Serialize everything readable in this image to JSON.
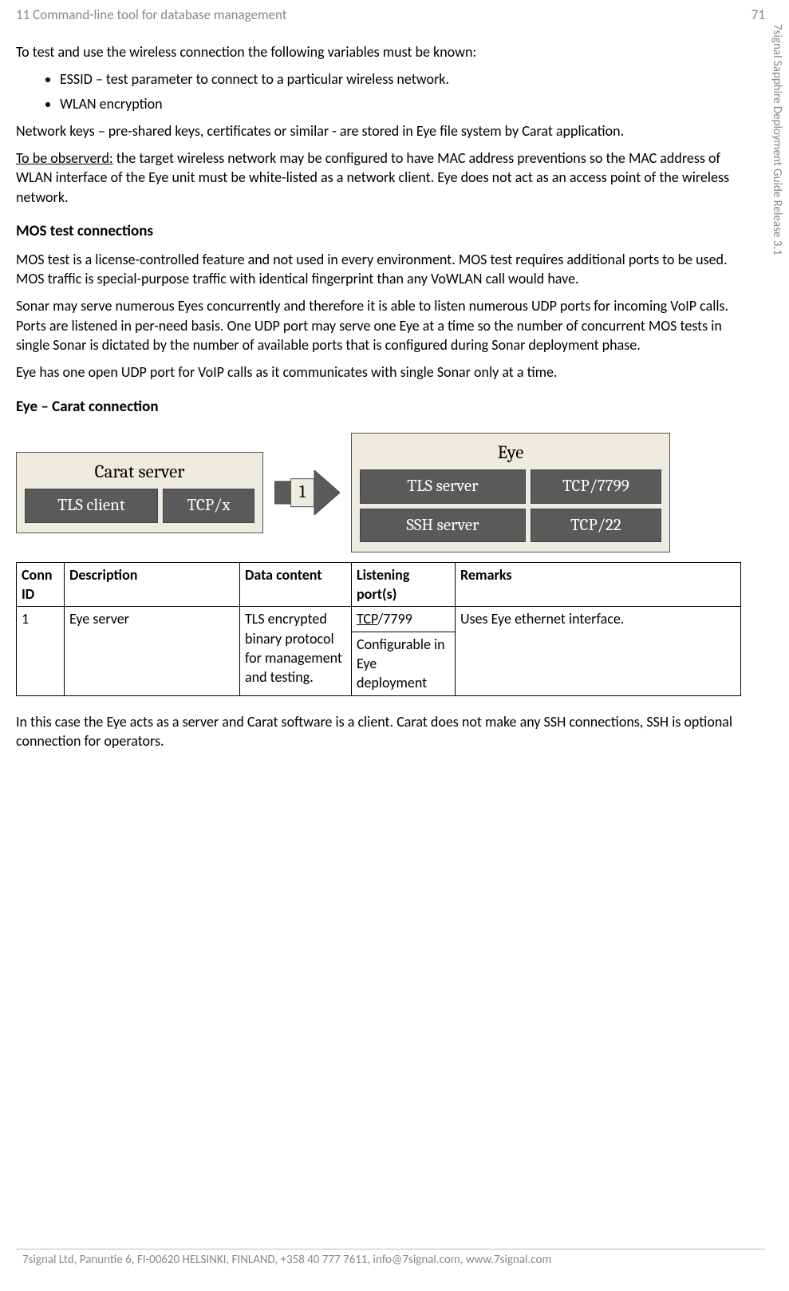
{
  "header": {
    "left": "11 Command-line tool for database management",
    "right": "71"
  },
  "side": "7signal Sapphire Deployment Guide Release 3.1",
  "intro": "To test and use the wireless connection the following variables must be known:",
  "bullets": [
    "ESSID – test parameter to connect to a particular wireless network.",
    "WLAN encryption"
  ],
  "p_netkeys": "Network keys – pre-shared keys, certificates or similar - are stored in Eye file system by Carat application.",
  "obs_label": "To be observerd:",
  "obs_text": " the target wireless network may be configured to have MAC address preventions so the MAC address of WLAN interface of the Eye unit must be white-listed as a network client. Eye does not act as an access point of the wireless network.",
  "h_mos": "MOS test connections",
  "mos_p1": "MOS test is a license-controlled feature and not used in every environment. MOS test requires additional ports to be used. MOS traffic is special-purpose traffic with identical fingerprint than any VoWLAN call would have.",
  "mos_p2": "Sonar may serve numerous Eyes concurrently and therefore it is able to listen numerous UDP ports for incoming VoIP calls. Ports are listened in per-need basis. One UDP port may serve one Eye at a time so the number of concurrent MOS tests in single Sonar is dictated by the number of available ports that is configured during Sonar deployment phase.",
  "mos_p3": "Eye has one open UDP port for VoIP calls as it communicates with single Sonar only at a time.",
  "h_eye": "Eye – Carat connection",
  "diagram": {
    "left_title": "Carat server",
    "left_r1a": "TLS client",
    "left_r1b": "TCP/x",
    "arrow": "1",
    "right_title": "Eye",
    "right_r1a": "TLS server",
    "right_r1b": "TCP/7799",
    "right_r2a": "SSH server",
    "right_r2b": "TCP/22"
  },
  "table": {
    "headers": [
      "Conn ID",
      "Description",
      "Data content",
      "Listening port(s)",
      "Remarks"
    ],
    "row": {
      "id": "1",
      "desc": "Eye server",
      "data": "TLS encrypted binary protocol for management and testing.",
      "port1a": "TCP",
      "port1b": "/7799",
      "port2": "Configurable in Eye deployment",
      "remarks": "Uses Eye ethernet interface."
    }
  },
  "closing": "In this case the Eye acts as a server and Carat software is a client. Carat does not make any SSH connections, SSH is optional connection for operators.",
  "footer": "7signal Ltd, Panuntie 6, FI-00620 HELSINKI, FINLAND, +358 40 777 7611, info@7signal.com, www.7signal.com"
}
